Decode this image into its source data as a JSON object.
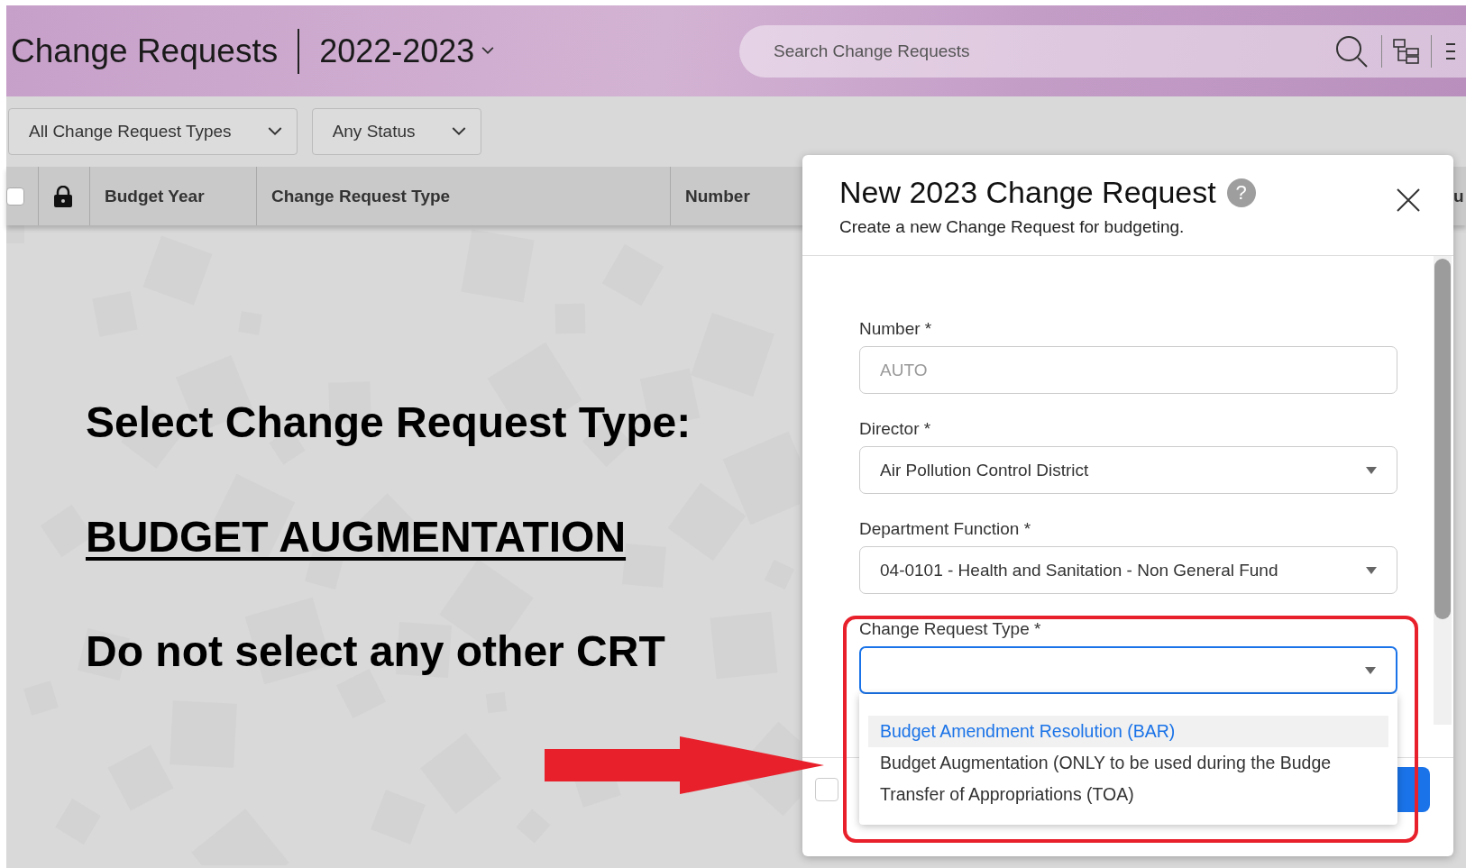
{
  "header": {
    "title": "Change Requests",
    "year": "2022-2023",
    "search": {
      "placeholder": "Search Change Requests"
    }
  },
  "filters": [
    {
      "label": "All Change Request Types"
    },
    {
      "label": "Any Status"
    }
  ],
  "table": {
    "select_all": {
      "checked": false
    },
    "columns": [
      "Budget Year",
      "Change Request Type",
      "Number",
      "u"
    ]
  },
  "annotation": {
    "lines": [
      {
        "text": "Select Change Request Type:",
        "underlined": false
      },
      {
        "text": "BUDGET AUGMENTATION",
        "underlined": true
      },
      {
        "text": "Do not select any other CRT",
        "underlined": false
      }
    ]
  },
  "dialog": {
    "title": "New 2023 Change Request",
    "help": "?",
    "subtitle": "Create a new Change Request for budgeting.",
    "fields": [
      {
        "kind": "text",
        "label": "Number *",
        "placeholder": "AUTO",
        "focused": false
      },
      {
        "kind": "select",
        "label": "Director *",
        "value": "Air Pollution Control District",
        "focused": false
      },
      {
        "kind": "select",
        "label": "Department Function *",
        "value": "04-0101 - Health and Sanitation - Non General Fund",
        "focused": false
      },
      {
        "kind": "select",
        "label": "Change Request Type *",
        "focused": true
      }
    ],
    "options": [
      {
        "label": "Budget Amendment Resolution (BAR)",
        "selected": true
      },
      {
        "label": "Budget Augmentation (ONLY to be used during the Budge",
        "selected": false
      },
      {
        "label": "Transfer of Appropriations (TOA)",
        "selected": false
      }
    ],
    "footer_checkbox": {
      "checked": false
    }
  }
}
